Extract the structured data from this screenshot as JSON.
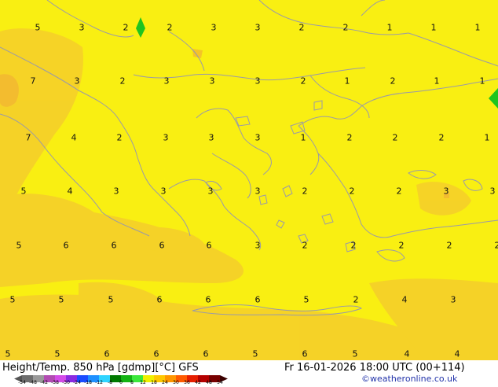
{
  "map": {
    "contour_values": [
      {
        "v": "5"
      },
      {
        "v": "3"
      },
      {
        "v": "2"
      },
      {
        "v": "2"
      },
      {
        "v": "3"
      },
      {
        "v": "3"
      },
      {
        "v": "2"
      },
      {
        "v": "2"
      },
      {
        "v": "1"
      },
      {
        "v": "1"
      },
      {
        "v": "1"
      },
      {
        "v": "7"
      },
      {
        "v": "3"
      },
      {
        "v": "2"
      },
      {
        "v": "3"
      },
      {
        "v": "3"
      },
      {
        "v": "3"
      },
      {
        "v": "2"
      },
      {
        "v": "1"
      },
      {
        "v": "2"
      },
      {
        "v": "1"
      },
      {
        "v": "1"
      },
      {
        "v": "7"
      },
      {
        "v": "4"
      },
      {
        "v": "2"
      },
      {
        "v": "3"
      },
      {
        "v": "3"
      },
      {
        "v": "3"
      },
      {
        "v": "1"
      },
      {
        "v": "2"
      },
      {
        "v": "2"
      },
      {
        "v": "2"
      },
      {
        "v": "1"
      },
      {
        "v": "5"
      },
      {
        "v": "4"
      },
      {
        "v": "3"
      },
      {
        "v": "3"
      },
      {
        "v": "3"
      },
      {
        "v": "3"
      },
      {
        "v": "2"
      },
      {
        "v": "2"
      },
      {
        "v": "2"
      },
      {
        "v": "3"
      },
      {
        "v": "3"
      },
      {
        "v": "5"
      },
      {
        "v": "6"
      },
      {
        "v": "6"
      },
      {
        "v": "6"
      },
      {
        "v": "6"
      },
      {
        "v": "3"
      },
      {
        "v": "2"
      },
      {
        "v": "2"
      },
      {
        "v": "2"
      },
      {
        "v": "2"
      },
      {
        "v": "2"
      },
      {
        "v": "5"
      },
      {
        "v": "5"
      },
      {
        "v": "5"
      },
      {
        "v": "6"
      },
      {
        "v": "6"
      },
      {
        "v": "6"
      },
      {
        "v": "5"
      },
      {
        "v": "2"
      },
      {
        "v": "4"
      },
      {
        "v": "3"
      },
      {
        "v": "5"
      },
      {
        "v": "5"
      },
      {
        "v": "6"
      },
      {
        "v": "6"
      },
      {
        "v": "6"
      },
      {
        "v": "5"
      },
      {
        "v": "6"
      },
      {
        "v": "5"
      },
      {
        "v": "4"
      },
      {
        "v": "4"
      }
    ]
  },
  "footer": {
    "title": "Height/Temp. 850 hPa [gdmp][°C] GFS",
    "datetime": "Fr 16-01-2026 18:00 UTC (00+114)",
    "credit": "©weatheronline.co.uk"
  },
  "colorbar": {
    "ticks": [
      "-54",
      "-48",
      "-42",
      "-38",
      "-30",
      "-24",
      "-18",
      "-12",
      "-8",
      "0",
      "8",
      "12",
      "18",
      "24",
      "30",
      "36",
      "42",
      "48",
      "54"
    ],
    "colors": [
      "#6e6e6e",
      "#9a9a9a",
      "#b24cb2",
      "#d44ce8",
      "#8a2be2",
      "#1a4cff",
      "#1e90ff",
      "#2fd4ff",
      "#007a00",
      "#14b414",
      "#3ce83c",
      "#f0f000",
      "#ffc800",
      "#ff9600",
      "#ff5a00",
      "#e61e00",
      "#b40000",
      "#780000"
    ]
  }
}
